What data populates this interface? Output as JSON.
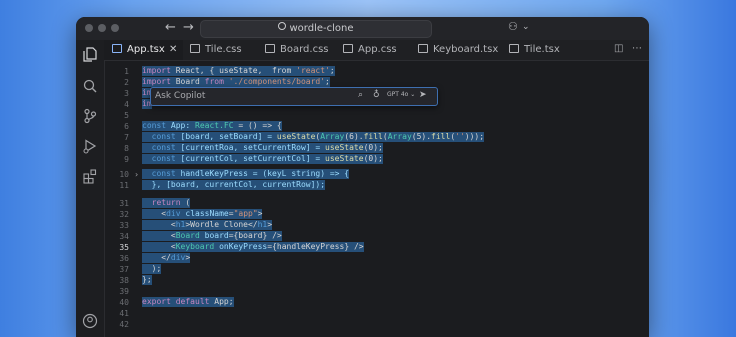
{
  "titlebar": {
    "back_glyph": "←",
    "forward_glyph": "→",
    "search_text": "wordle-clone",
    "copilot_glyph": "⚇",
    "copilot_caret": "⌄"
  },
  "tabs": [
    {
      "label": "App.tsx",
      "active": true,
      "close": "✕"
    },
    {
      "label": "Tile.css",
      "active": false
    },
    {
      "label": "Board.css",
      "active": false
    },
    {
      "label": "App.css",
      "active": false
    },
    {
      "label": "Keyboard.tsx",
      "active": false
    },
    {
      "label": "Tile.tsx",
      "active": false
    }
  ],
  "tab_actions": {
    "split": "◫",
    "more": "⋯"
  },
  "copilot_bar": {
    "placeholder": "Ask Copilot",
    "model_label": "GPT 4o",
    "caret": "⌄",
    "attach_glyph": "⌕",
    "mic_glyph": "♁",
    "send_glyph": "➤"
  },
  "gutter": {
    "line_numbers": [
      "1",
      "2",
      "3",
      "4",
      "5",
      "6",
      "7",
      "8",
      "9",
      "10",
      "11",
      "31",
      "32",
      "33",
      "34",
      "35",
      "36",
      "37",
      "38",
      "39",
      "40",
      "41",
      "42"
    ],
    "current_line": "35",
    "fold_marker": "›"
  },
  "code": {
    "l1": [
      "import",
      " React, { useState,  from ",
      "'react'",
      ";"
    ],
    "l2": [
      "import",
      " Board ",
      "from",
      " ",
      "'./components/board'",
      ";"
    ],
    "l3": [
      "im"
    ],
    "l4": [
      "im"
    ],
    "l6": [
      "const",
      " App: ",
      "React.FC",
      " = () => {"
    ],
    "l7": [
      "  const",
      " [board, setBoard] = ",
      "useState",
      "(",
      "Array",
      "(6).",
      "fill",
      "(",
      "Array",
      "(5).",
      "fill",
      "(",
      "''",
      ")));"
    ],
    "l8": [
      "  const",
      " [currentRoa, setCurrentRow] = ",
      "useState",
      "(0);"
    ],
    "l9": [
      "  const",
      " [currentCol, setCurrentCol] = ",
      "useState",
      "(0);"
    ],
    "l10": [
      "  const",
      " handleKeyPress = (keyL string) => {"
    ],
    "l11": [
      "  }, [board, currentCol, currentRow]);"
    ],
    "l31": [
      "  return",
      " ("
    ],
    "l32": [
      "    <",
      "div",
      " ",
      "className",
      "=",
      "\"app\"",
      ">"
    ],
    "l33": [
      "      <",
      "h1",
      ">Wordle Clone</",
      "h1",
      ">"
    ],
    "l34": [
      "      <",
      "Board",
      " ",
      "board",
      "={board} />"
    ],
    "l35": [
      "      <",
      "Keyboard",
      " ",
      "onKeyPress",
      "={handleKeyPress} />"
    ],
    "l36": [
      "    </",
      "div",
      ">"
    ],
    "l37": [
      "  );"
    ],
    "l38": [
      "};"
    ],
    "l39": [
      "export",
      " ",
      "default",
      " App;"
    ]
  }
}
